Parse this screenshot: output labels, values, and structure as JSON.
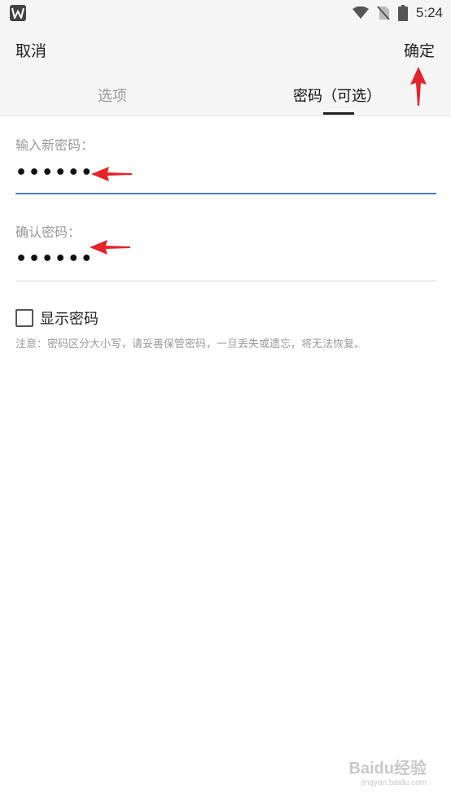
{
  "status_bar": {
    "time": "5:24",
    "icons": [
      "wps-app-icon",
      "wifi-icon",
      "no-sim-icon",
      "battery-icon"
    ]
  },
  "header": {
    "cancel_label": "取消",
    "confirm_label": "确定",
    "tabs": [
      {
        "label": "选项",
        "active": false
      },
      {
        "label": "密码（可选）",
        "active": true
      }
    ]
  },
  "form": {
    "new_password": {
      "label": "输入新密码：",
      "value": "••••••"
    },
    "confirm_password": {
      "label": "确认密码：",
      "value": "••••••"
    },
    "show_password": {
      "label": "显示密码",
      "checked": false
    },
    "note": "注意：密码区分大小写，请妥善保管密码，一旦丢失或遗忘，将无法恢复。"
  },
  "annotations": {
    "arrow_color": "#e3242b"
  },
  "watermark": {
    "brand": "Baidu经验",
    "sub": "jingyan.baidu.com"
  },
  "colors": {
    "accent": "#4a7fd6",
    "header_bg": "#f5f5f5"
  }
}
